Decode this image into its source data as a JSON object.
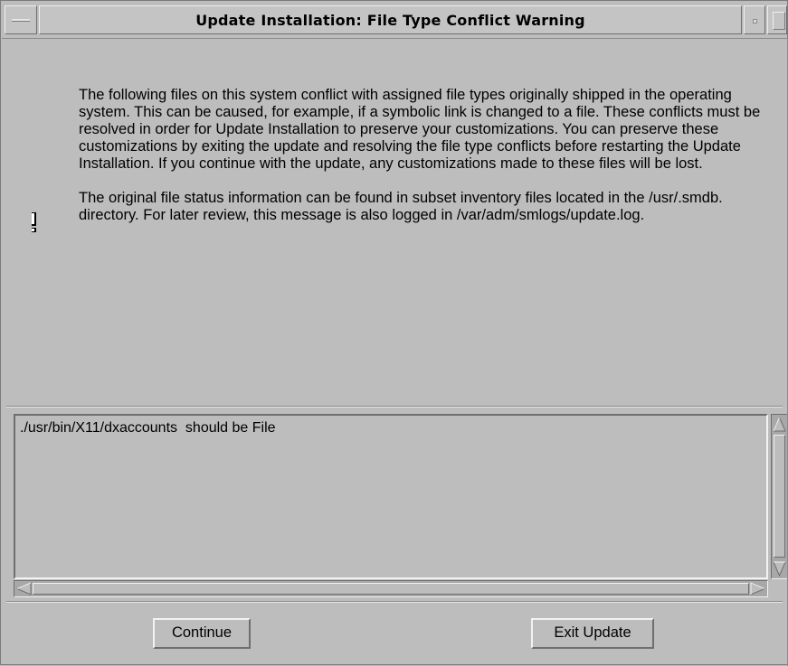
{
  "window": {
    "title": "Update Installation: File Type Conflict Warning"
  },
  "message": {
    "icon": "exclamation-icon",
    "paragraph1": "The following files on this system conflict with assigned file types originally shipped in the operating system.  This can be caused, for example, if a symbolic link is changed to a file.  These conflicts must be resolved in order for Update Installation to preserve your customizations.  You can preserve these customizations by exiting the update and resolving the file type conflicts before restarting the Update Installation. If you continue with the update, any customizations made to these files will be lost.",
    "paragraph2": "The original file status information can be found in subset inventory files located in the /usr/.smdb. directory. For later review, this message is also logged in /var/adm/smlogs/update.log."
  },
  "conflicts": {
    "lines": [
      "./usr/bin/X11/dxaccounts  should be File"
    ]
  },
  "buttons": {
    "continue_label": "Continue",
    "exit_label": "Exit Update"
  }
}
